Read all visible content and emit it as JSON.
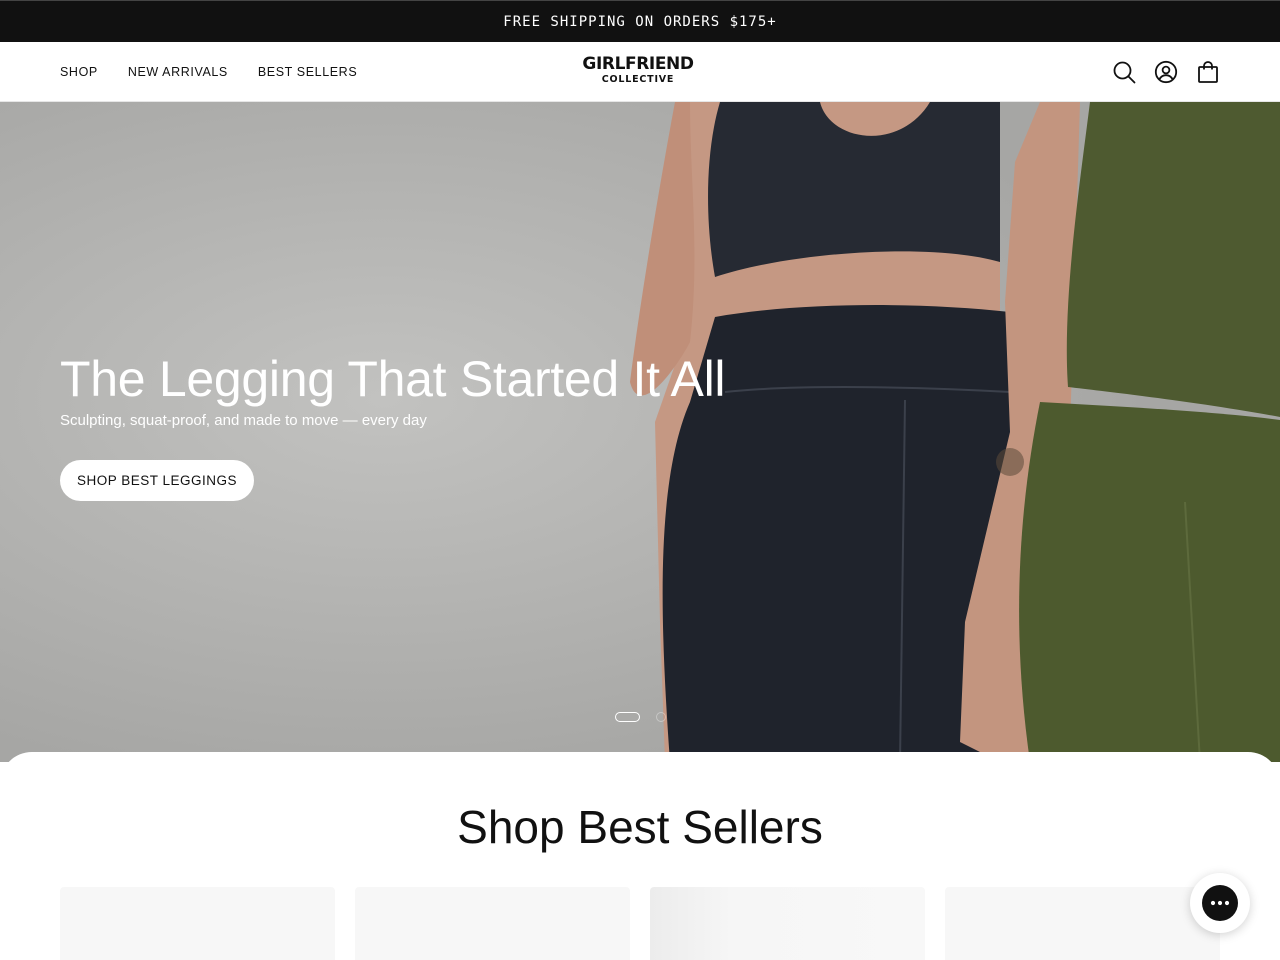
{
  "announcement": {
    "text": "FREE SHIPPING ON ORDERS $175+"
  },
  "header": {
    "nav": [
      {
        "label": "SHOP"
      },
      {
        "label": "NEW ARRIVALS"
      },
      {
        "label": "BEST SELLERS"
      }
    ],
    "logo": {
      "line1": "GIRLFRIEND",
      "line2": "COLLECTIVE"
    },
    "icons": [
      "search-icon",
      "account-icon",
      "bag-icon"
    ]
  },
  "hero": {
    "title": "The Legging That Started It All",
    "subtitle": "Sculpting, squat-proof, and made to move — every day",
    "cta": "SHOP BEST LEGGINGS",
    "slides": {
      "count": 2,
      "active": 1
    }
  },
  "best_sellers": {
    "title": "Shop Best Sellers",
    "card_count": 4
  },
  "chat": {
    "icon": "chat-icon"
  },
  "colors": {
    "announcement_bg": "#111111",
    "hero_bg": "#b4b4b2",
    "button_bg": "#ffffff",
    "text": "#111111"
  }
}
